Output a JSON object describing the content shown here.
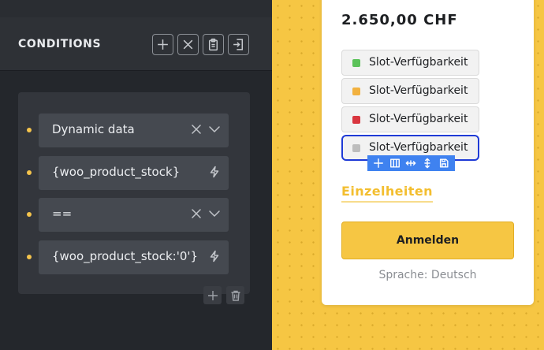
{
  "builder": {
    "title": "CONDITIONS",
    "header_actions": [
      {
        "icon": "plus-icon"
      },
      {
        "icon": "close-icon"
      },
      {
        "icon": "clipboard-icon"
      },
      {
        "icon": "import-icon"
      }
    ],
    "conditions": [
      {
        "value": "Dynamic data",
        "icons": [
          "clear-icon",
          "chevron-down-icon"
        ]
      },
      {
        "value": "{woo_product_stock}",
        "icons": [
          "bolt-icon"
        ]
      },
      {
        "value": "==",
        "icons": [
          "clear-icon",
          "chevron-down-icon"
        ]
      },
      {
        "value": "{woo_product_stock:'0'}",
        "icons": [
          "bolt-icon"
        ]
      }
    ],
    "group_actions": [
      {
        "icon": "plus-icon"
      },
      {
        "icon": "trash-icon"
      }
    ]
  },
  "preview": {
    "price": "2.650,00 CHF",
    "slots": [
      {
        "label": "Slot-Verfügbarkeit",
        "color": "#5cc25a"
      },
      {
        "label": "Slot-Verfügbarkeit",
        "color": "#f2b13f"
      },
      {
        "label": "Slot-Verfügbarkeit",
        "color": "#d9363f"
      },
      {
        "label": "Slot-Verfügbarkeit",
        "color": "#bdbdbd"
      }
    ],
    "element_toolbar": [
      "plus-icon",
      "columns-icon",
      "move-horizontal-icon",
      "move-vertical-icon",
      "save-icon"
    ],
    "details_link": "Einzelheiten",
    "cta_label": "Anmelden",
    "language": "Sprache: Deutsch"
  },
  "colors": {
    "accent": "#f6c643",
    "selection": "#1f3bd6",
    "toolbar": "#3f82f0"
  }
}
